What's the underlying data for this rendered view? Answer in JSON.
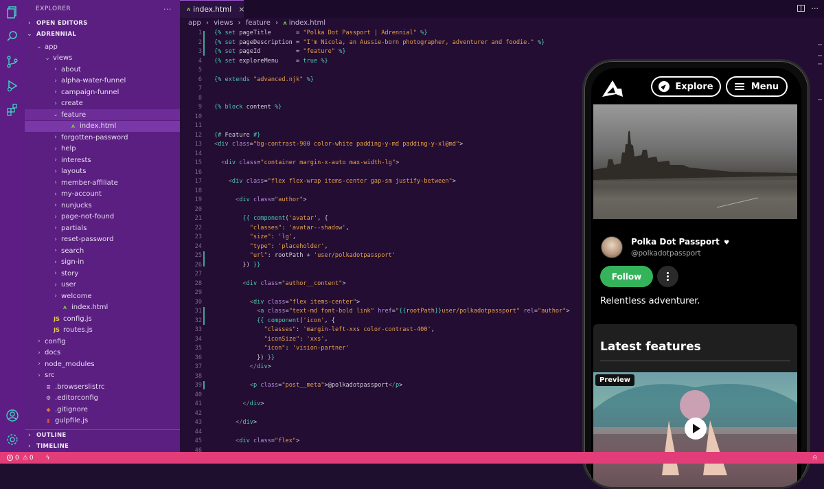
{
  "activity_bar": {
    "icons": [
      "files-icon",
      "search-icon",
      "source-control-icon",
      "run-debug-icon",
      "extensions-icon",
      "account-icon",
      "settings-gear-icon"
    ]
  },
  "explorer": {
    "title": "EXPLORER",
    "more": "···",
    "open_editors": "OPEN EDITORS",
    "project": "ADRENNIAL",
    "outline": "OUTLINE",
    "timeline": "TIMELINE",
    "tree": [
      {
        "label": "app",
        "indent": 1,
        "type": "folder-open"
      },
      {
        "label": "views",
        "indent": 2,
        "type": "folder-open"
      },
      {
        "label": "about",
        "indent": 3,
        "type": "folder"
      },
      {
        "label": "alpha-water-funnel",
        "indent": 3,
        "type": "folder"
      },
      {
        "label": "campaign-funnel",
        "indent": 3,
        "type": "folder"
      },
      {
        "label": "create",
        "indent": 3,
        "type": "folder"
      },
      {
        "label": "feature",
        "indent": 3,
        "type": "folder-open",
        "selected": true
      },
      {
        "label": "index.html",
        "indent": 4,
        "type": "njk",
        "active": true
      },
      {
        "label": "forgotten-password",
        "indent": 3,
        "type": "folder"
      },
      {
        "label": "help",
        "indent": 3,
        "type": "folder"
      },
      {
        "label": "interests",
        "indent": 3,
        "type": "folder"
      },
      {
        "label": "layouts",
        "indent": 3,
        "type": "folder"
      },
      {
        "label": "member-affiliate",
        "indent": 3,
        "type": "folder"
      },
      {
        "label": "my-account",
        "indent": 3,
        "type": "folder"
      },
      {
        "label": "nunjucks",
        "indent": 3,
        "type": "folder"
      },
      {
        "label": "page-not-found",
        "indent": 3,
        "type": "folder"
      },
      {
        "label": "partials",
        "indent": 3,
        "type": "folder"
      },
      {
        "label": "reset-password",
        "indent": 3,
        "type": "folder"
      },
      {
        "label": "search",
        "indent": 3,
        "type": "folder"
      },
      {
        "label": "sign-in",
        "indent": 3,
        "type": "folder"
      },
      {
        "label": "story",
        "indent": 3,
        "type": "folder"
      },
      {
        "label": "user",
        "indent": 3,
        "type": "folder"
      },
      {
        "label": "welcome",
        "indent": 3,
        "type": "folder"
      },
      {
        "label": "index.html",
        "indent": 3,
        "type": "njk"
      },
      {
        "label": "config.js",
        "indent": 2,
        "type": "js"
      },
      {
        "label": "routes.js",
        "indent": 2,
        "type": "js"
      },
      {
        "label": "config",
        "indent": 1,
        "type": "folder"
      },
      {
        "label": "docs",
        "indent": 1,
        "type": "folder"
      },
      {
        "label": "node_modules",
        "indent": 1,
        "type": "folder"
      },
      {
        "label": "src",
        "indent": 1,
        "type": "folder"
      },
      {
        "label": ".browserslistrc",
        "indent": 1,
        "type": "list"
      },
      {
        "label": ".editorconfig",
        "indent": 1,
        "type": "gear"
      },
      {
        "label": ".gitignore",
        "indent": 1,
        "type": "git"
      },
      {
        "label": "gulpfile.js",
        "indent": 1,
        "type": "gulp"
      }
    ]
  },
  "editor": {
    "tab_label": "index.html",
    "tab_close": "×",
    "breadcrumb": [
      "app",
      "views",
      "feature",
      "index.html"
    ],
    "breadcrumb_sep": "›",
    "lines": [
      "{% set pageTitle       = \"Polka Dot Passport | Adrennial\" %}",
      "{% set pageDescription = \"I'm Nicola, an Aussie-born photographer, adventurer and foodie.\" %}",
      "{% set pageId          = \"feature\" %}",
      "{% set exploreMenu     = true %}",
      "",
      "{% extends \"advanced.njk\" %}",
      "",
      "",
      "{% block content %}",
      "",
      "",
      "{# Feature #}",
      "<div class=\"bg-contrast-900 color-white padding-y-md padding-y-xl@md\">",
      "",
      "  <div class=\"container margin-x-auto max-width-lg\">",
      "",
      "    <div class=\"flex flex-wrap items-center gap-sm justify-between\">",
      "",
      "      <div class=\"author\">",
      "",
      "        {{ component('avatar', {",
      "          \"classes\": 'avatar--shadow',",
      "          \"size\": 'lg',",
      "          \"type\": 'placeholder',",
      "          \"url\": rootPath + 'user/polkadotpassport'",
      "        }) }}",
      "",
      "        <div class=\"author__content\">",
      "",
      "          <div class=\"flex items-center\">",
      "            <a class=\"text-md font-bold link\" href=\"{{rootPath}}user/polkadotpassport\" rel=\"author\">",
      "            {{ component('icon', {",
      "              \"classes\": 'margin-left-xxs color-contrast-400',",
      "              \"iconSize\": 'xxs',",
      "              \"icon\": 'vision-partner'",
      "            }) }}",
      "          </div>",
      "",
      "          <p class=\"post__meta\">@polkadotpassport</p>",
      "",
      "        </div>",
      "",
      "      </div>",
      "",
      "      <div class=\"flex\">",
      ""
    ]
  },
  "phone": {
    "explore_label": "Explore",
    "menu_label": "Menu",
    "author_name": "Polka Dot Passport",
    "author_handle": "@polkadotpassport",
    "follow_label": "Follow",
    "bio": "Relentless adventurer.",
    "latest_heading": "Latest features",
    "preview_badge": "Preview"
  },
  "status": {
    "errors": "0",
    "warnings": "0"
  },
  "colors": {
    "activity_bar": "#5d1d84",
    "sidebar": "#5a1f80",
    "editor_bg": "#230d33",
    "status_bar": "#e23d78",
    "follow_green": "#35b35a"
  }
}
